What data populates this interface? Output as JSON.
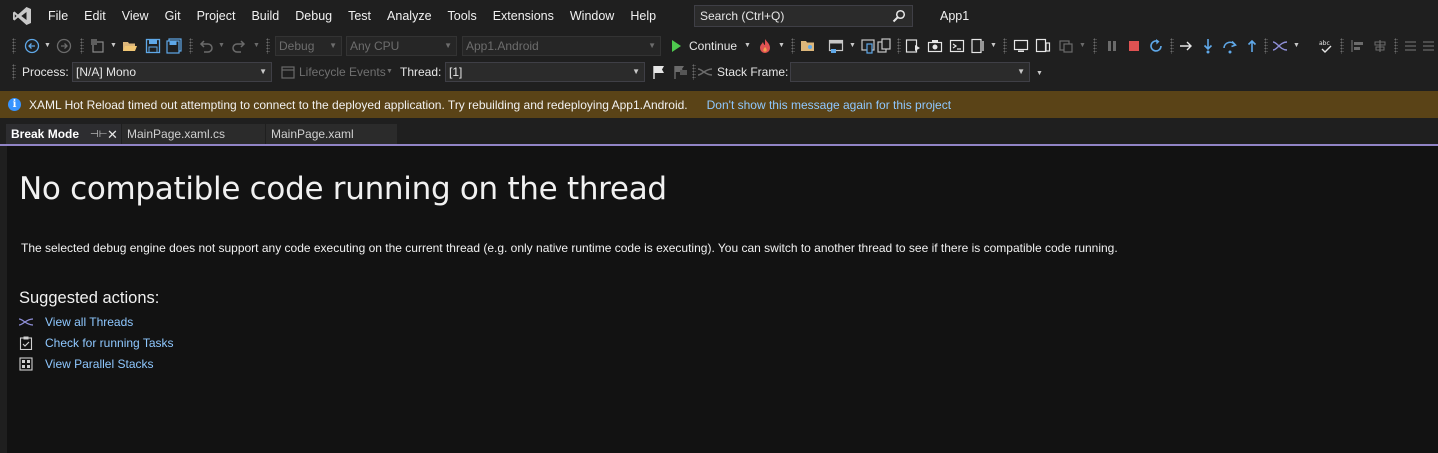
{
  "menubar": {
    "items": [
      "File",
      "Edit",
      "View",
      "Git",
      "Project",
      "Build",
      "Debug",
      "Test",
      "Analyze",
      "Tools",
      "Extensions",
      "Window",
      "Help"
    ],
    "search_placeholder": "Search (Ctrl+Q)",
    "app_title": "App1"
  },
  "toolbar": {
    "config": "Debug",
    "platform": "Any CPU",
    "startup_project": "App1.Android",
    "continue_label": "Continue"
  },
  "debug_location": {
    "process_label": "Process:",
    "process_value": "[N/A] Mono",
    "lifecycle_label": "Lifecycle Events",
    "thread_label": "Thread:",
    "thread_value": "[1]",
    "stack_frame_label": "Stack Frame:",
    "stack_frame_value": ""
  },
  "infobar": {
    "message": "XAML Hot Reload timed out attempting to connect to the deployed application. Try rebuilding and redeploying App1.Android.",
    "link": "Don't show this message again for this project"
  },
  "tabs": [
    {
      "label": "Break Mode",
      "active": true
    },
    {
      "label": "MainPage.xaml.cs",
      "active": false
    },
    {
      "label": "MainPage.xaml",
      "active": false
    }
  ],
  "content": {
    "title": "No compatible code running on the thread",
    "description": "The selected debug engine does not support any code executing on the current thread (e.g. only native runtime code is executing). You can switch to another thread to see if there is compatible code running.",
    "suggested_heading": "Suggested actions:",
    "actions": [
      {
        "label": "View all Threads",
        "icon": "threads-icon"
      },
      {
        "label": "Check for running Tasks",
        "icon": "tasks-icon"
      },
      {
        "label": "View Parallel Stacks",
        "icon": "parallel-stacks-icon"
      }
    ]
  },
  "colors": {
    "infobar_bg": "#5a4317",
    "link": "#8fc8ff",
    "tab_accent": "#9184c6",
    "continue_green": "#4ec94e",
    "stop_red": "#e05252"
  }
}
